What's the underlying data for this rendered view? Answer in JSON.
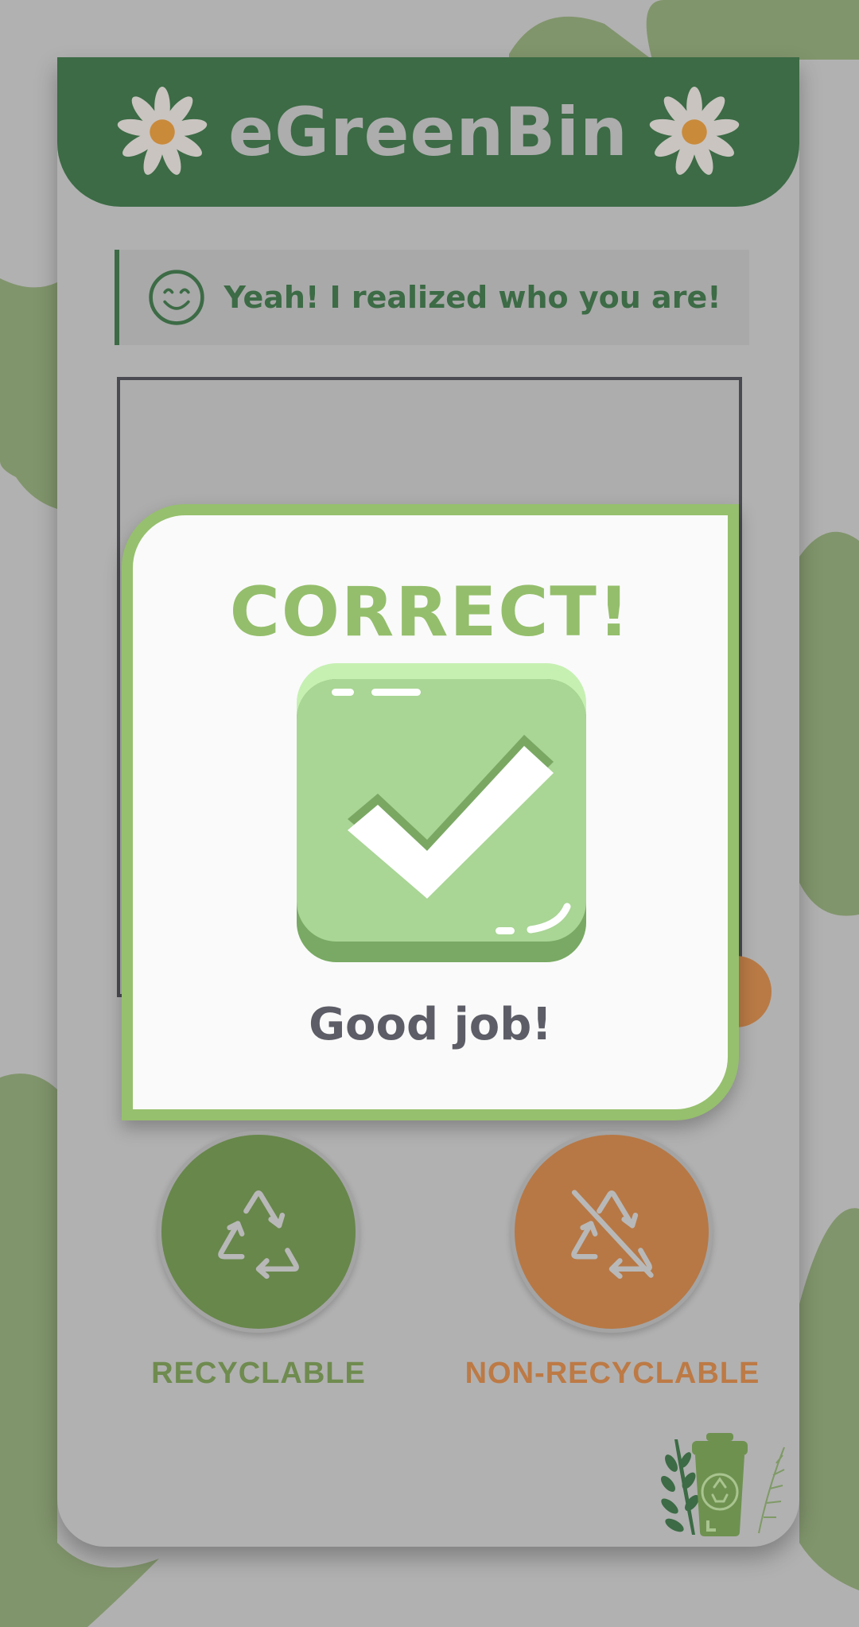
{
  "app": {
    "title": "eGreenBin"
  },
  "banner": {
    "icon": "smiley-face-icon",
    "message": "Yeah! I realized who you are!"
  },
  "result_modal": {
    "heading": "CORRECT!",
    "icon": "check-mark-icon",
    "subtext": "Good job!"
  },
  "bins": [
    {
      "label": "RECYCLABLE",
      "icon": "recycle-icon",
      "color": "#68874b"
    },
    {
      "label": "NON-RECYCLABLE",
      "icon": "no-recycle-icon",
      "color": "#b77845"
    }
  ],
  "colors": {
    "brand_green": "#3c6b45",
    "accent_green": "#96c06d",
    "accent_orange": "#b77845",
    "background": "#b1b1b1"
  }
}
